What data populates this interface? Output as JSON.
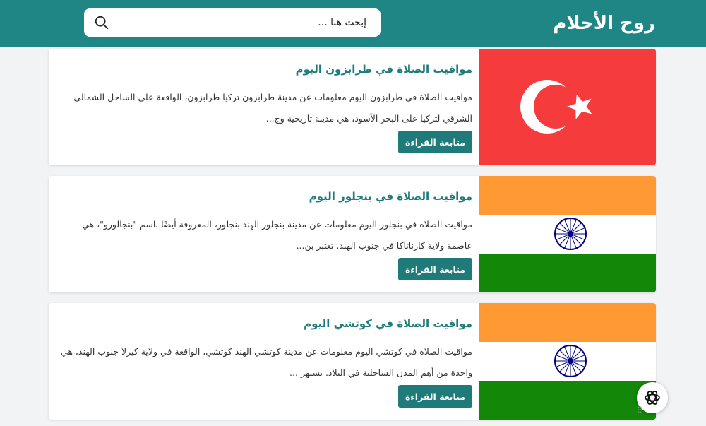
{
  "header": {
    "logo": "روح الأحلام",
    "search_placeholder": "إبحث هنا ...",
    "background": "#1f8585"
  },
  "posts": [
    {
      "title": "مواقيت الصلاة في طرابزون اليوم",
      "excerpt": "مواقيت الصلاة في طرابزون اليوم معلومات عن مدينة طرابزون تركيا طرابزون، الواقعة على الساحل الشمالي الشرقي لتركيا على البحر الأسود، هي مدينة تاريخية وج...",
      "read_more": "متابعة القراءة",
      "image": "turkey-flag"
    },
    {
      "title": "مواقيت الصلاة في بنجلور اليوم",
      "excerpt": "مواقيت الصلاة في بنجلور اليوم معلومات عن مدينة بنجلور الهند بنجلور، المعروفة أيضًا باسم \"بنجالورو\"، هي عاصمة ولاية كارناتاكا في جنوب الهند. تعتبر بن...",
      "read_more": "متابعة القراءة",
      "image": "india-flag"
    },
    {
      "title": "مواقيت الصلاة في كوتشي اليوم",
      "excerpt": "مواقيت الصلاة في كوتشي اليوم معلومات عن مدينة كوتشي الهند كوتشي، الواقعة في ولاية كيرلا جنوب الهند، هي واحدة من أهم المدن الساحلية في البلاد. تشتهر ...",
      "read_more": "متابعة القراءة",
      "image": "india-flag"
    }
  ],
  "colors": {
    "accent": "#1f7a7a",
    "turkey_red": "#f53b3b",
    "india_saffron": "#ff9933",
    "india_green": "#138808",
    "chakra_navy": "#000080"
  }
}
